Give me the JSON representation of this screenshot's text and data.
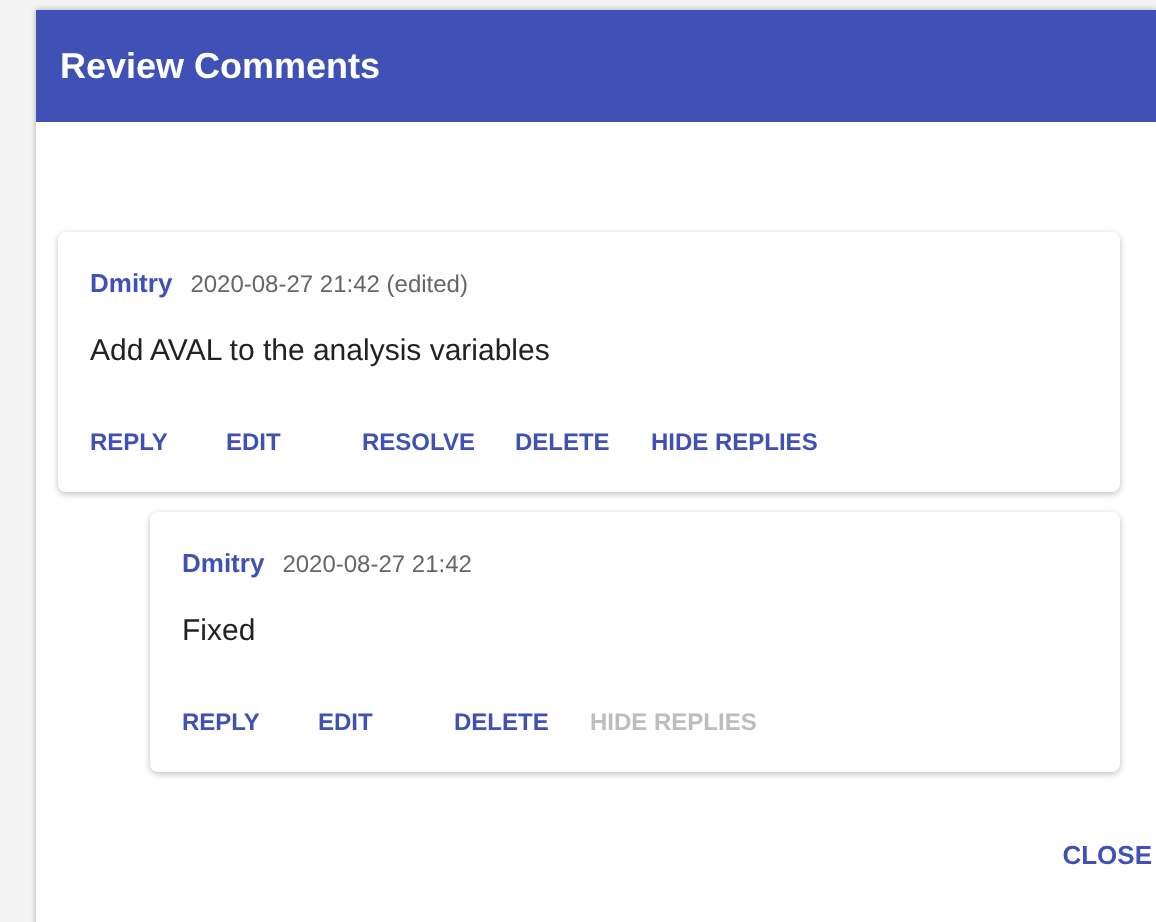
{
  "dialog": {
    "title": "Review Comments",
    "comments": [
      {
        "author": "Dmitry",
        "timestamp": "2020-08-27 21:42 (edited)",
        "text": "Add AVAL to the analysis variables",
        "actions": [
          {
            "label": "REPLY",
            "disabled": false
          },
          {
            "label": "EDIT",
            "disabled": false
          },
          {
            "label": "RESOLVE",
            "disabled": false
          },
          {
            "label": "DELETE",
            "disabled": false
          },
          {
            "label": "HIDE REPLIES",
            "disabled": false
          }
        ],
        "children": [
          {
            "author": "Dmitry",
            "timestamp": "2020-08-27 21:42",
            "text": "Fixed",
            "actions": [
              {
                "label": "REPLY",
                "disabled": false
              },
              {
                "label": "EDIT",
                "disabled": false
              },
              {
                "label": "DELETE",
                "disabled": false
              },
              {
                "label": "HIDE REPLIES",
                "disabled": true
              }
            ]
          }
        ]
      }
    ],
    "buttons": [
      {
        "label": "CLOSE"
      }
    ]
  }
}
